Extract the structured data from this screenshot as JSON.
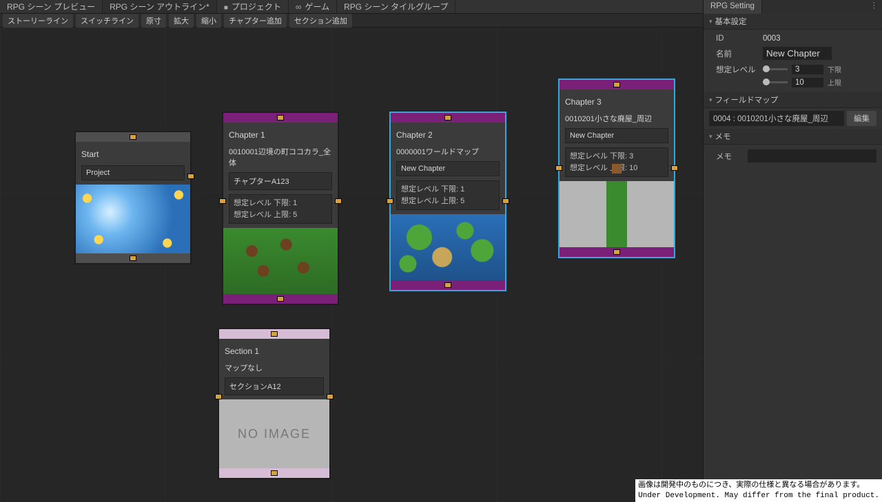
{
  "tabs": {
    "preview": "RPG シーン プレビュー",
    "outline": "RPG シーン アウトライン*",
    "project": "プロジェクト",
    "game": "ゲーム",
    "tilegroup": "RPG シーン タイルグループ",
    "setting": "RPG Setting"
  },
  "toolbar": {
    "storyline": "ストーリーライン",
    "switchline": "スイッチライン",
    "genshu": "原寸",
    "zoomin": "拡大",
    "zoomout": "縮小",
    "addchapter": "チャプター追加",
    "addsection": "セクション追加"
  },
  "nodes": {
    "start": {
      "title": "Start",
      "field": "Project"
    },
    "ch1": {
      "title": "Chapter 1",
      "map": "0010001辺境の町ココカラ_全体",
      "field": "チャプターA123",
      "stat1": "想定レベル 下限: 1",
      "stat2": "想定レベル 上限: 5"
    },
    "ch2": {
      "title": "Chapter 2",
      "map": "0000001ワールドマップ",
      "field": "New Chapter",
      "stat1": "想定レベル 下限: 1",
      "stat2": "想定レベル 上限: 5"
    },
    "ch3": {
      "title": "Chapter 3",
      "map": "0010201小さな廃屋_周辺",
      "field": "New Chapter",
      "stat1": "想定レベル 下限: 3",
      "stat2": "想定レベル 上限: 10"
    },
    "sec1": {
      "title": "Section 1",
      "map": "マップなし",
      "field": "セクションA12",
      "noimg": "NO IMAGE"
    }
  },
  "inspector": {
    "basic": "基本設定",
    "id_label": "ID",
    "id_val": "0003",
    "name_label": "名前",
    "name_val": "New Chapter",
    "level_label": "想定レベル",
    "low_val": "3",
    "low_lbl": "下限",
    "high_val": "10",
    "high_lbl": "上限",
    "fieldmap": "フィールドマップ",
    "fieldmap_val": "0004 : 0010201小さな廃屋_周辺",
    "edit": "編集",
    "memo_section": "メモ",
    "memo_label": "メモ"
  },
  "disclaimer": "画像は開発中のものにつき、実際の仕様と異なる場合があります。\nUnder Development. May differ from the final product."
}
